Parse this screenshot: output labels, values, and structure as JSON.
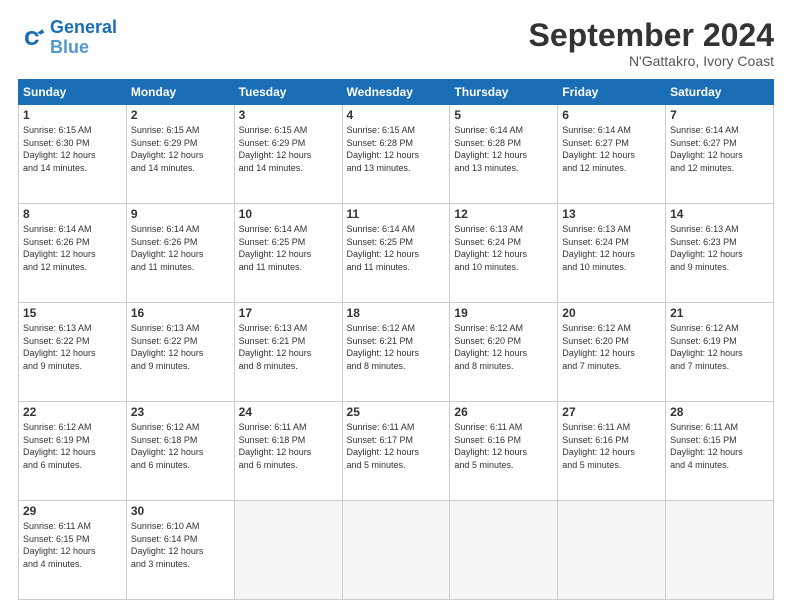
{
  "header": {
    "logo_line1": "General",
    "logo_line2": "Blue",
    "title": "September 2024",
    "subtitle": "N'Gattakro, Ivory Coast"
  },
  "weekdays": [
    "Sunday",
    "Monday",
    "Tuesday",
    "Wednesday",
    "Thursday",
    "Friday",
    "Saturday"
  ],
  "weeks": [
    [
      {
        "day": "1",
        "info": "Sunrise: 6:15 AM\nSunset: 6:30 PM\nDaylight: 12 hours\nand 14 minutes."
      },
      {
        "day": "2",
        "info": "Sunrise: 6:15 AM\nSunset: 6:29 PM\nDaylight: 12 hours\nand 14 minutes."
      },
      {
        "day": "3",
        "info": "Sunrise: 6:15 AM\nSunset: 6:29 PM\nDaylight: 12 hours\nand 14 minutes."
      },
      {
        "day": "4",
        "info": "Sunrise: 6:15 AM\nSunset: 6:28 PM\nDaylight: 12 hours\nand 13 minutes."
      },
      {
        "day": "5",
        "info": "Sunrise: 6:14 AM\nSunset: 6:28 PM\nDaylight: 12 hours\nand 13 minutes."
      },
      {
        "day": "6",
        "info": "Sunrise: 6:14 AM\nSunset: 6:27 PM\nDaylight: 12 hours\nand 12 minutes."
      },
      {
        "day": "7",
        "info": "Sunrise: 6:14 AM\nSunset: 6:27 PM\nDaylight: 12 hours\nand 12 minutes."
      }
    ],
    [
      {
        "day": "8",
        "info": "Sunrise: 6:14 AM\nSunset: 6:26 PM\nDaylight: 12 hours\nand 12 minutes."
      },
      {
        "day": "9",
        "info": "Sunrise: 6:14 AM\nSunset: 6:26 PM\nDaylight: 12 hours\nand 11 minutes."
      },
      {
        "day": "10",
        "info": "Sunrise: 6:14 AM\nSunset: 6:25 PM\nDaylight: 12 hours\nand 11 minutes."
      },
      {
        "day": "11",
        "info": "Sunrise: 6:14 AM\nSunset: 6:25 PM\nDaylight: 12 hours\nand 11 minutes."
      },
      {
        "day": "12",
        "info": "Sunrise: 6:13 AM\nSunset: 6:24 PM\nDaylight: 12 hours\nand 10 minutes."
      },
      {
        "day": "13",
        "info": "Sunrise: 6:13 AM\nSunset: 6:24 PM\nDaylight: 12 hours\nand 10 minutes."
      },
      {
        "day": "14",
        "info": "Sunrise: 6:13 AM\nSunset: 6:23 PM\nDaylight: 12 hours\nand 9 minutes."
      }
    ],
    [
      {
        "day": "15",
        "info": "Sunrise: 6:13 AM\nSunset: 6:22 PM\nDaylight: 12 hours\nand 9 minutes."
      },
      {
        "day": "16",
        "info": "Sunrise: 6:13 AM\nSunset: 6:22 PM\nDaylight: 12 hours\nand 9 minutes."
      },
      {
        "day": "17",
        "info": "Sunrise: 6:13 AM\nSunset: 6:21 PM\nDaylight: 12 hours\nand 8 minutes."
      },
      {
        "day": "18",
        "info": "Sunrise: 6:12 AM\nSunset: 6:21 PM\nDaylight: 12 hours\nand 8 minutes."
      },
      {
        "day": "19",
        "info": "Sunrise: 6:12 AM\nSunset: 6:20 PM\nDaylight: 12 hours\nand 8 minutes."
      },
      {
        "day": "20",
        "info": "Sunrise: 6:12 AM\nSunset: 6:20 PM\nDaylight: 12 hours\nand 7 minutes."
      },
      {
        "day": "21",
        "info": "Sunrise: 6:12 AM\nSunset: 6:19 PM\nDaylight: 12 hours\nand 7 minutes."
      }
    ],
    [
      {
        "day": "22",
        "info": "Sunrise: 6:12 AM\nSunset: 6:19 PM\nDaylight: 12 hours\nand 6 minutes."
      },
      {
        "day": "23",
        "info": "Sunrise: 6:12 AM\nSunset: 6:18 PM\nDaylight: 12 hours\nand 6 minutes."
      },
      {
        "day": "24",
        "info": "Sunrise: 6:11 AM\nSunset: 6:18 PM\nDaylight: 12 hours\nand 6 minutes."
      },
      {
        "day": "25",
        "info": "Sunrise: 6:11 AM\nSunset: 6:17 PM\nDaylight: 12 hours\nand 5 minutes."
      },
      {
        "day": "26",
        "info": "Sunrise: 6:11 AM\nSunset: 6:16 PM\nDaylight: 12 hours\nand 5 minutes."
      },
      {
        "day": "27",
        "info": "Sunrise: 6:11 AM\nSunset: 6:16 PM\nDaylight: 12 hours\nand 5 minutes."
      },
      {
        "day": "28",
        "info": "Sunrise: 6:11 AM\nSunset: 6:15 PM\nDaylight: 12 hours\nand 4 minutes."
      }
    ],
    [
      {
        "day": "29",
        "info": "Sunrise: 6:11 AM\nSunset: 6:15 PM\nDaylight: 12 hours\nand 4 minutes."
      },
      {
        "day": "30",
        "info": "Sunrise: 6:10 AM\nSunset: 6:14 PM\nDaylight: 12 hours\nand 3 minutes."
      },
      {
        "day": "",
        "info": ""
      },
      {
        "day": "",
        "info": ""
      },
      {
        "day": "",
        "info": ""
      },
      {
        "day": "",
        "info": ""
      },
      {
        "day": "",
        "info": ""
      }
    ]
  ]
}
